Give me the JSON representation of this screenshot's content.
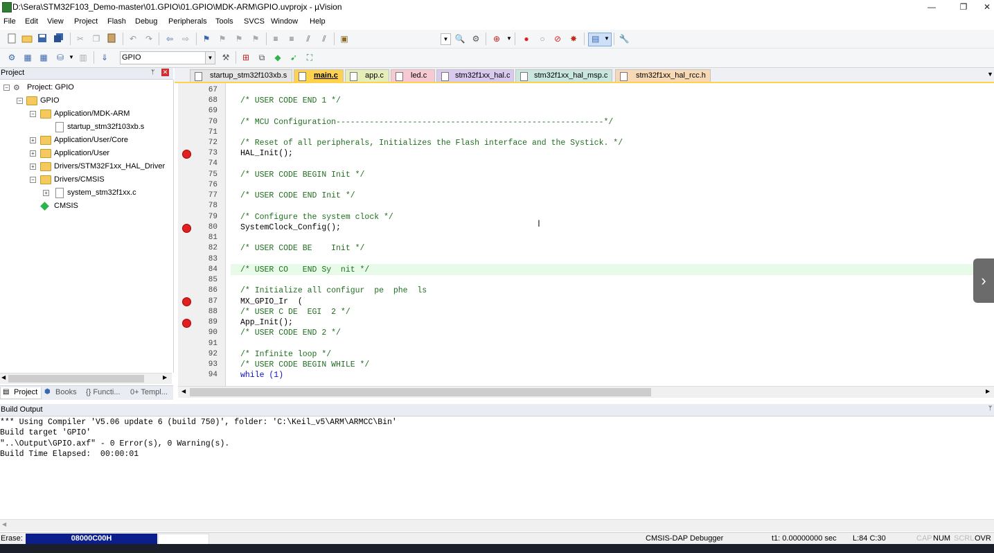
{
  "window": {
    "title": "D:\\Sera\\STM32F103_Demo-master\\01.GPIO\\01.GPIO\\MDK-ARM\\GPIO.uvprojx - µVision",
    "minimize": "—",
    "restore": "❐",
    "close": "✕"
  },
  "menu": [
    "File",
    "Edit",
    "View",
    "Project",
    "Flash",
    "Debug",
    "Peripherals",
    "Tools",
    "SVCS",
    "Window",
    "Help"
  ],
  "toolbar": {
    "target_select": "GPIO"
  },
  "project_panel": {
    "title": "Project",
    "pin": "📌",
    "close": "✕",
    "tree": [
      {
        "label": "Project: GPIO"
      },
      {
        "label": "GPIO"
      },
      {
        "label": "Application/MDK-ARM"
      },
      {
        "label": "startup_stm32f103xb.s"
      },
      {
        "label": "Application/User/Core"
      },
      {
        "label": "Application/User"
      },
      {
        "label": "Drivers/STM32F1xx_HAL_Driver"
      },
      {
        "label": "Drivers/CMSIS"
      },
      {
        "label": "system_stm32f1xx.c"
      },
      {
        "label": "CMSIS"
      }
    ],
    "tabs": [
      "Project",
      "Books",
      "{} Functi...",
      "0+ Templ..."
    ]
  },
  "editor": {
    "tabs": [
      "startup_stm32f103xb.s",
      "main.c",
      "app.c",
      "led.c",
      "stm32f1xx_hal.c",
      "stm32f1xx_hal_msp.c",
      "stm32f1xx_hal_rcc.h"
    ],
    "active_tab": "main.c",
    "line_numbers": [
      "67",
      "68",
      "69",
      "70",
      "71",
      "72",
      "73",
      "74",
      "75",
      "76",
      "77",
      "78",
      "79",
      "80",
      "81",
      "82",
      "83",
      "84",
      "85",
      "86",
      "87",
      "88",
      "89",
      "90",
      "91",
      "92",
      "93",
      "94"
    ],
    "lines": [
      "",
      "/* USER CODE END 1 */",
      "",
      "/* MCU Configuration--------------------------------------------------------*/",
      "",
      "/* Reset of all peripherals, Initializes the Flash interface and the Systick. */",
      "HAL_Init();",
      "",
      "/* USER CODE BEGIN Init */",
      "",
      "/* USER CODE END Init */",
      "",
      "/* Configure the system clock */",
      "SystemClock_Config();",
      "",
      "/* USER CODE BE    Init */",
      "",
      "/* USER CO   END Sy  nit */",
      "",
      "/* Initialize all configur  pe  phe  ls",
      "MX_GPIO_Ir  (",
      "/* USER C DE  EGI  2 */",
      "App_Init();",
      "/* USER CODE END 2 */",
      "",
      "/* Infinite loop */",
      "/* USER CODE BEGIN WHILE */",
      "while (1)"
    ]
  },
  "build_output": {
    "title": "Build Output",
    "lines": [
      "*** Using Compiler 'V5.06 update 6 (build 750)', folder: 'C:\\Keil_v5\\ARM\\ARMCC\\Bin'",
      "Build target 'GPIO'",
      "\"..\\Output\\GPIO.axf\" - 0 Error(s), 0 Warning(s).",
      "Build Time Elapsed:  00:00:01"
    ]
  },
  "status": {
    "erase_label": "Erase:",
    "erase_value": "08000C00H",
    "debugger": "CMSIS-DAP Debugger",
    "time": "t1: 0.00000000 sec",
    "position": "L:84 C:30",
    "cap": "CAP",
    "num": "NUM",
    "scrl": "SCRL",
    "ovr": "OVR"
  },
  "colors": {
    "comment": "#1f6f1f",
    "keyword": "#1010c0",
    "breakpoint": "#e02020",
    "erase_bg": "#0b1f8c"
  }
}
